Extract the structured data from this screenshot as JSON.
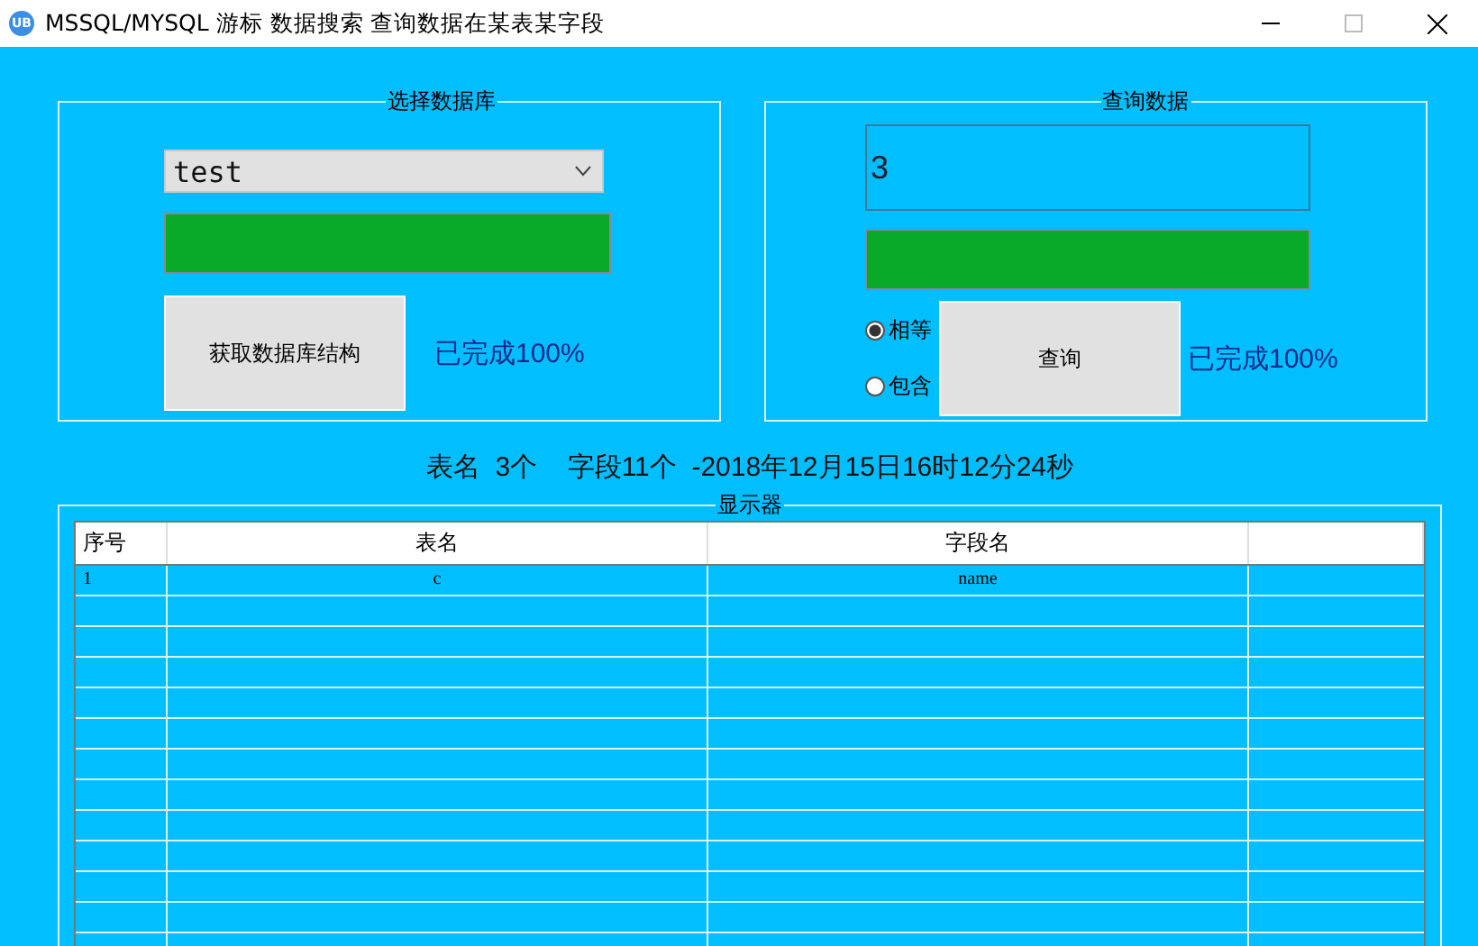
{
  "window": {
    "title": "MSSQL/MYSQL 游标 数据搜索 查询数据在某表某字段",
    "app_icon": "UB"
  },
  "database_group": {
    "title": "选择数据库",
    "database": "test",
    "progress": {
      "level": 1
    },
    "button": "获取数据库结构",
    "status": "已完成100%"
  },
  "query_group": {
    "title": "查询数据",
    "query": "3",
    "progress": {
      "level": 1
    },
    "match_modes": [
      {
        "label": "相等",
        "selected": true
      },
      {
        "label": "包含",
        "selected": false
      }
    ],
    "button": "查询",
    "status": "已完成100%"
  },
  "summary": "表名  3个    字段11个  -2018年12月15日16时12分24秒",
  "display_group": {
    "title": "显示器",
    "table": {
      "columns": [
        "序号",
        "表名",
        "字段名",
        ""
      ],
      "rows": [
        [
          "1",
          "c",
          "name",
          ""
        ]
      ]
    }
  }
}
